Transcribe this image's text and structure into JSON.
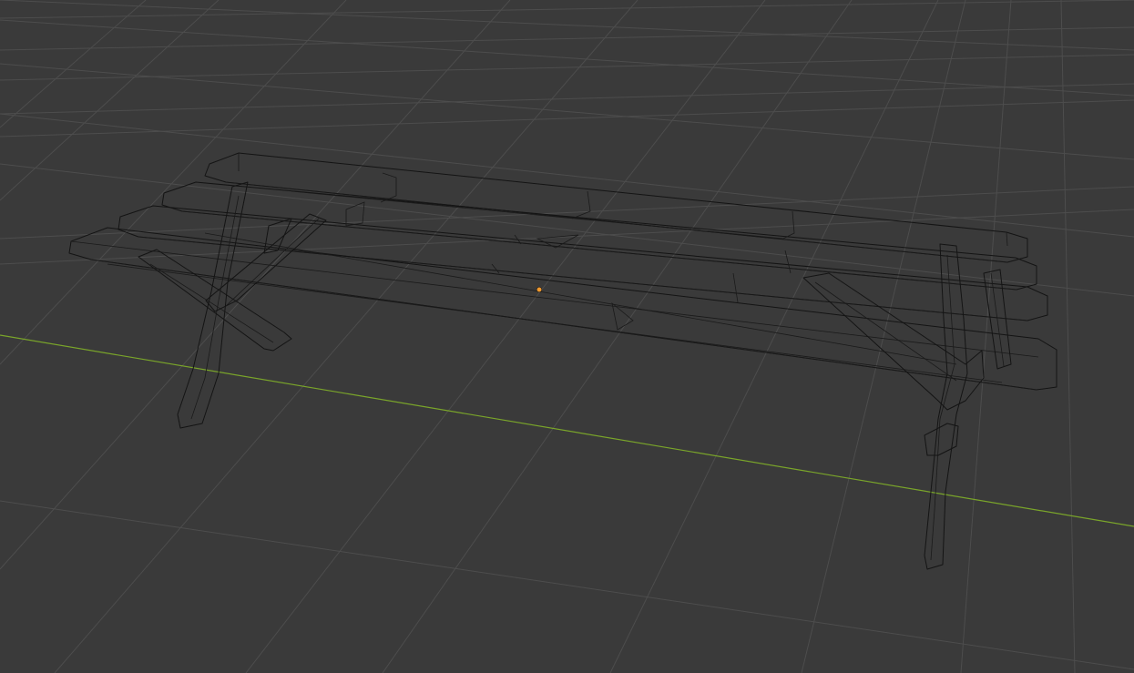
{
  "viewport": {
    "background": "#3a3a3a",
    "grid_color": "#4d4d4d",
    "x_axis_color": "#7aa52a",
    "object_origin_color": "#f29a2e",
    "shading_mode": "wireframe",
    "object": "bench"
  }
}
